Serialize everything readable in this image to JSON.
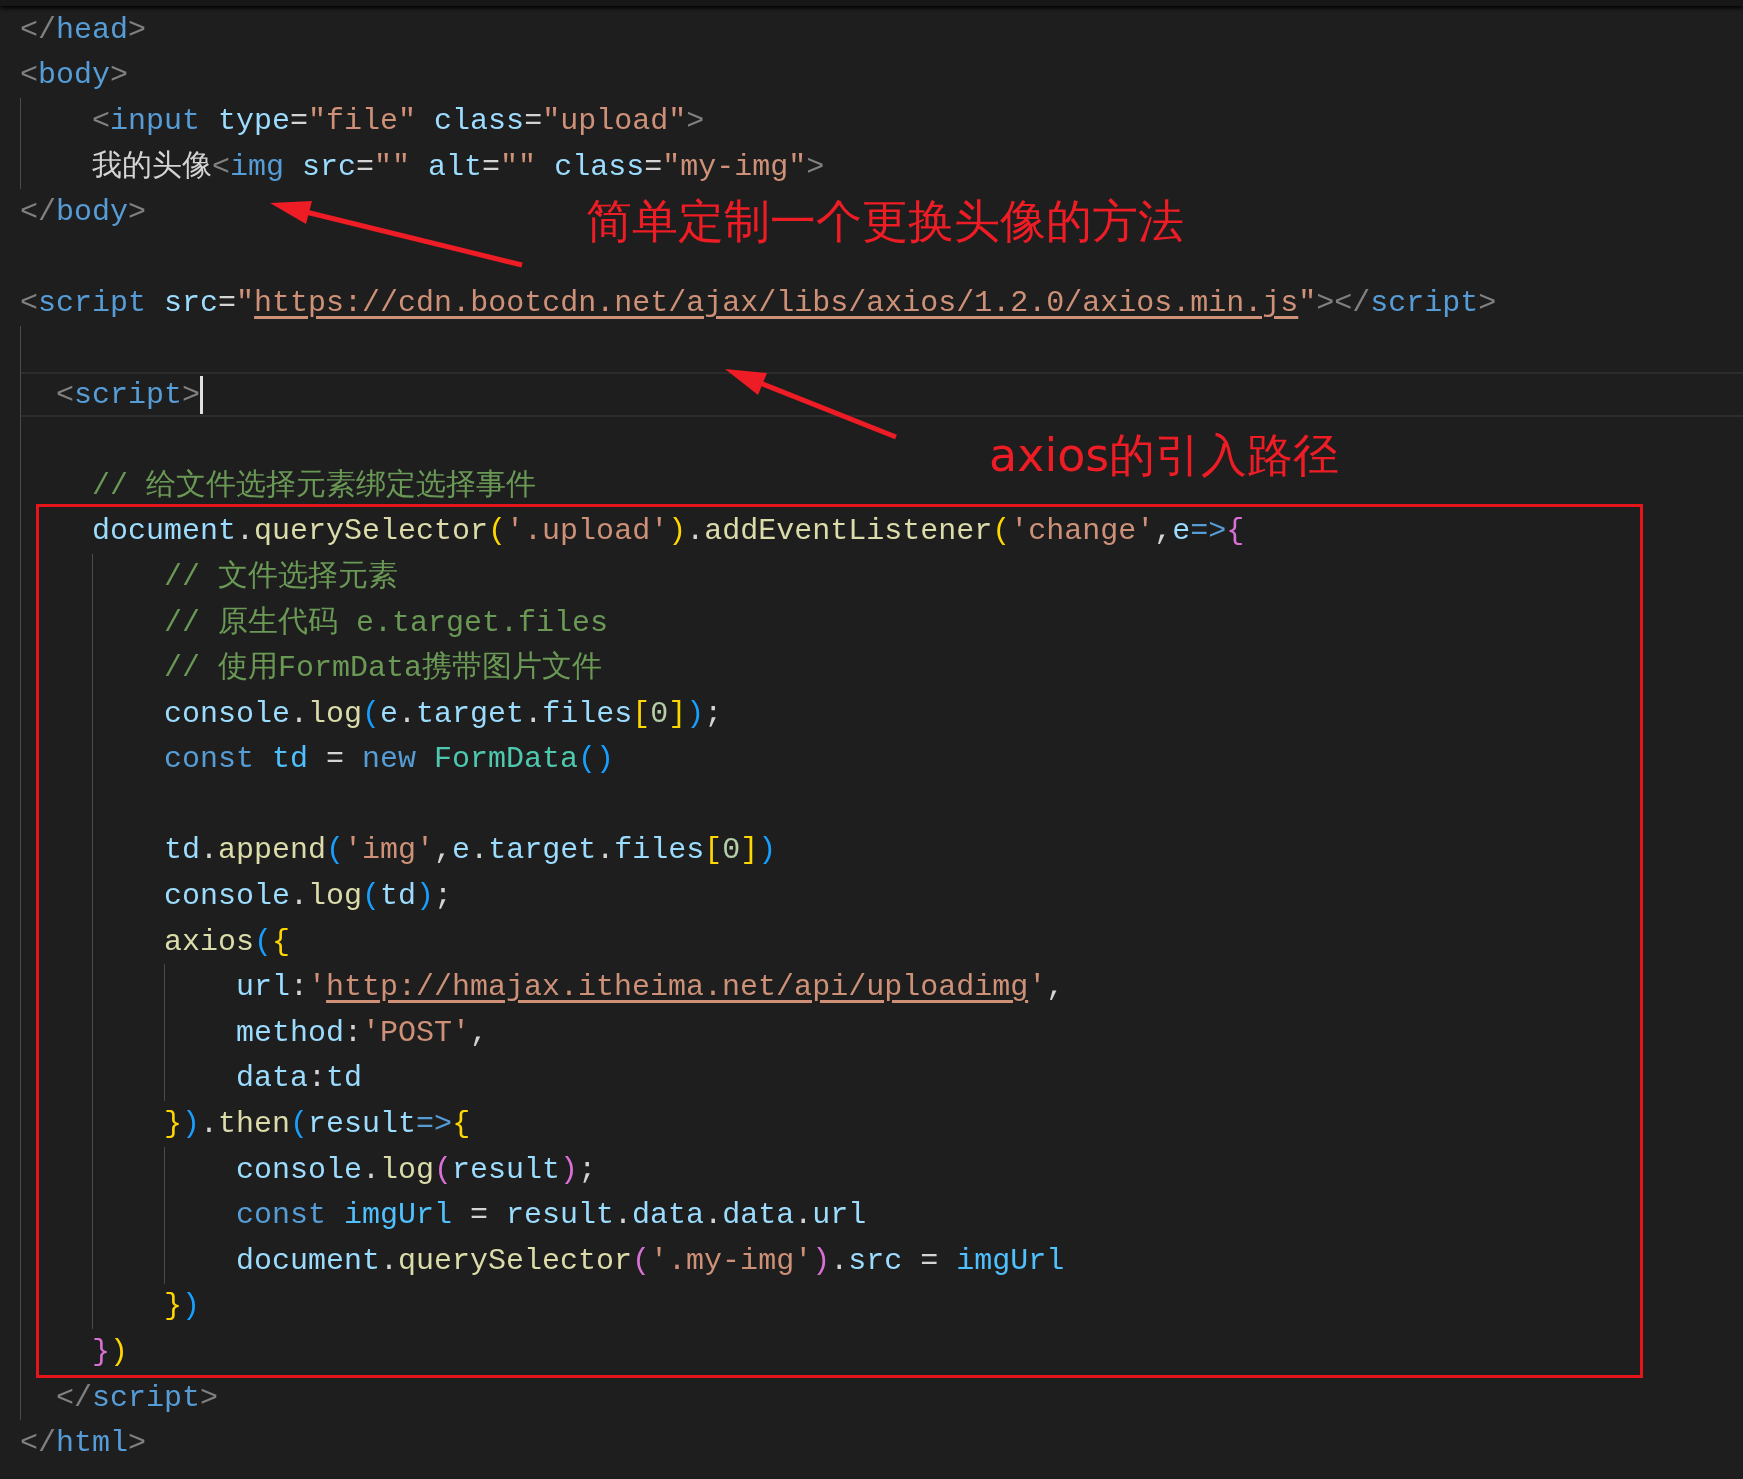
{
  "editor": {
    "lines": [
      {
        "kind": "code",
        "tokens": [
          {
            "kind": "p",
            "text": "</"
          },
          {
            "kind": "tag",
            "text": "head"
          },
          {
            "kind": "p",
            "text": ">"
          }
        ]
      },
      {
        "kind": "code",
        "tokens": [
          {
            "kind": "p",
            "text": "<"
          },
          {
            "kind": "tag",
            "text": "body"
          },
          {
            "kind": "p",
            "text": ">"
          }
        ],
        "children": [
          {
            "kind": "code",
            "tokens": [
              {
                "kind": "p",
                "text": "<"
              },
              {
                "kind": "tag",
                "text": "input"
              },
              {
                "kind": "attr",
                "text": " type"
              },
              {
                "kind": "op",
                "text": "="
              },
              {
                "kind": "str",
                "text": "\"file\""
              },
              {
                "kind": "attr",
                "text": " class"
              },
              {
                "kind": "op",
                "text": "="
              },
              {
                "kind": "str",
                "text": "\"upload\""
              },
              {
                "kind": "p",
                "text": ">"
              }
            ]
          },
          {
            "kind": "code",
            "tokens": [
              {
                "kind": "text",
                "text": "我的头像"
              },
              {
                "kind": "p",
                "text": "<"
              },
              {
                "kind": "tag",
                "text": "img"
              },
              {
                "kind": "attr",
                "text": " src"
              },
              {
                "kind": "op",
                "text": "="
              },
              {
                "kind": "str",
                "text": "\"\""
              },
              {
                "kind": "attr",
                "text": " alt"
              },
              {
                "kind": "op",
                "text": "="
              },
              {
                "kind": "str",
                "text": "\"\""
              },
              {
                "kind": "attr",
                "text": " class"
              },
              {
                "kind": "op",
                "text": "="
              },
              {
                "kind": "str",
                "text": "\"my-img\""
              },
              {
                "kind": "p",
                "text": ">"
              }
            ]
          }
        ]
      },
      {
        "kind": "code",
        "tokens": [
          {
            "kind": "p",
            "text": "</"
          },
          {
            "kind": "tag",
            "text": "body"
          },
          {
            "kind": "p",
            "text": ">"
          }
        ]
      },
      {
        "kind": "blank"
      },
      {
        "kind": "code",
        "tokens": [
          {
            "kind": "p",
            "text": "<"
          },
          {
            "kind": "tag",
            "text": "script"
          },
          {
            "kind": "attr",
            "text": " src"
          },
          {
            "kind": "op",
            "text": "="
          },
          {
            "kind": "str",
            "text": "\""
          },
          {
            "kind": "link",
            "text": "https://cdn.bootcdn.net/ajax/libs/axios/1.2.0/axios.min.js"
          },
          {
            "kind": "str",
            "text": "\""
          },
          {
            "kind": "p",
            "text": "></"
          },
          {
            "kind": "tag",
            "text": "script"
          },
          {
            "kind": "p",
            "text": ">"
          }
        ],
        "children": [
          {
            "kind": "blank"
          },
          {
            "kind": "half",
            "current": true,
            "tokens": [
              {
                "kind": "p",
                "text": "<"
              },
              {
                "kind": "tag",
                "text": "script"
              },
              {
                "kind": "p",
                "text": ">"
              }
            ]
          },
          {
            "kind": "blank"
          },
          {
            "kind": "code",
            "tokens": [
              {
                "kind": "cmt",
                "text": "// 给文件选择元素绑定选择事件"
              }
            ]
          },
          {
            "kind": "code",
            "tokens": [
              {
                "kind": "var",
                "text": "document"
              },
              {
                "kind": "op",
                "text": "."
              },
              {
                "kind": "fn",
                "text": "querySelector"
              },
              {
                "kind": "b1",
                "text": "("
              },
              {
                "kind": "str",
                "text": "'.upload'"
              },
              {
                "kind": "b1",
                "text": ")"
              },
              {
                "kind": "op",
                "text": "."
              },
              {
                "kind": "fn",
                "text": "addEventListener"
              },
              {
                "kind": "b1",
                "text": "("
              },
              {
                "kind": "str",
                "text": "'change'"
              },
              {
                "kind": "op",
                "text": ","
              },
              {
                "kind": "var",
                "text": "e"
              },
              {
                "kind": "kw",
                "text": "=>"
              },
              {
                "kind": "b2",
                "text": "{"
              }
            ],
            "children": [
              {
                "kind": "code",
                "tokens": [
                  {
                    "kind": "cmt",
                    "text": "// 文件选择元素"
                  }
                ]
              },
              {
                "kind": "code",
                "tokens": [
                  {
                    "kind": "cmt",
                    "text": "// 原生代码 e.target.files"
                  }
                ]
              },
              {
                "kind": "code",
                "tokens": [
                  {
                    "kind": "cmt",
                    "text": "// 使用FormData携带图片文件"
                  }
                ]
              },
              {
                "kind": "code",
                "tokens": [
                  {
                    "kind": "var",
                    "text": "console"
                  },
                  {
                    "kind": "op",
                    "text": "."
                  },
                  {
                    "kind": "fn",
                    "text": "log"
                  },
                  {
                    "kind": "b3",
                    "text": "("
                  },
                  {
                    "kind": "var",
                    "text": "e"
                  },
                  {
                    "kind": "op",
                    "text": "."
                  },
                  {
                    "kind": "var",
                    "text": "target"
                  },
                  {
                    "kind": "op",
                    "text": "."
                  },
                  {
                    "kind": "var",
                    "text": "files"
                  },
                  {
                    "kind": "b1",
                    "text": "["
                  },
                  {
                    "kind": "num",
                    "text": "0"
                  },
                  {
                    "kind": "b1",
                    "text": "]"
                  },
                  {
                    "kind": "b3",
                    "text": ")"
                  },
                  {
                    "kind": "op",
                    "text": ";"
                  }
                ]
              },
              {
                "kind": "code",
                "tokens": [
                  {
                    "kind": "kw",
                    "text": "const"
                  },
                  {
                    "kind": "cv",
                    "text": " td"
                  },
                  {
                    "kind": "op",
                    "text": " = "
                  },
                  {
                    "kind": "kw",
                    "text": "new"
                  },
                  {
                    "kind": "cls",
                    "text": " FormData"
                  },
                  {
                    "kind": "b3",
                    "text": "()"
                  }
                ]
              },
              {
                "kind": "blank"
              },
              {
                "kind": "code",
                "tokens": [
                  {
                    "kind": "var",
                    "text": "td"
                  },
                  {
                    "kind": "op",
                    "text": "."
                  },
                  {
                    "kind": "fn",
                    "text": "append"
                  },
                  {
                    "kind": "b3",
                    "text": "("
                  },
                  {
                    "kind": "str",
                    "text": "'img'"
                  },
                  {
                    "kind": "op",
                    "text": ","
                  },
                  {
                    "kind": "var",
                    "text": "e"
                  },
                  {
                    "kind": "op",
                    "text": "."
                  },
                  {
                    "kind": "var",
                    "text": "target"
                  },
                  {
                    "kind": "op",
                    "text": "."
                  },
                  {
                    "kind": "var",
                    "text": "files"
                  },
                  {
                    "kind": "b1",
                    "text": "["
                  },
                  {
                    "kind": "num",
                    "text": "0"
                  },
                  {
                    "kind": "b1",
                    "text": "]"
                  },
                  {
                    "kind": "b3",
                    "text": ")"
                  }
                ]
              },
              {
                "kind": "code",
                "tokens": [
                  {
                    "kind": "var",
                    "text": "console"
                  },
                  {
                    "kind": "op",
                    "text": "."
                  },
                  {
                    "kind": "fn",
                    "text": "log"
                  },
                  {
                    "kind": "b3",
                    "text": "("
                  },
                  {
                    "kind": "var",
                    "text": "td"
                  },
                  {
                    "kind": "b3",
                    "text": ")"
                  },
                  {
                    "kind": "op",
                    "text": ";"
                  }
                ]
              },
              {
                "kind": "code",
                "tokens": [
                  {
                    "kind": "fn",
                    "text": "axios"
                  },
                  {
                    "kind": "b3",
                    "text": "("
                  },
                  {
                    "kind": "b1",
                    "text": "{"
                  }
                ],
                "children": [
                  {
                    "kind": "code",
                    "tokens": [
                      {
                        "kind": "var",
                        "text": "url"
                      },
                      {
                        "kind": "op",
                        "text": ":"
                      },
                      {
                        "kind": "str",
                        "text": "'"
                      },
                      {
                        "kind": "link",
                        "text": "http://hmajax.itheima.net/api/uploadimg"
                      },
                      {
                        "kind": "str",
                        "text": "'"
                      },
                      {
                        "kind": "op",
                        "text": ","
                      }
                    ]
                  },
                  {
                    "kind": "code",
                    "tokens": [
                      {
                        "kind": "var",
                        "text": "method"
                      },
                      {
                        "kind": "op",
                        "text": ":"
                      },
                      {
                        "kind": "str",
                        "text": "'POST'"
                      },
                      {
                        "kind": "op",
                        "text": ","
                      }
                    ]
                  },
                  {
                    "kind": "code",
                    "tokens": [
                      {
                        "kind": "var",
                        "text": "data"
                      },
                      {
                        "kind": "op",
                        "text": ":"
                      },
                      {
                        "kind": "var",
                        "text": "td"
                      }
                    ]
                  }
                ]
              },
              {
                "kind": "code",
                "tokens": [
                  {
                    "kind": "b1",
                    "text": "}"
                  },
                  {
                    "kind": "b3",
                    "text": ")"
                  },
                  {
                    "kind": "op",
                    "text": "."
                  },
                  {
                    "kind": "fn",
                    "text": "then"
                  },
                  {
                    "kind": "b3",
                    "text": "("
                  },
                  {
                    "kind": "var",
                    "text": "result"
                  },
                  {
                    "kind": "kw",
                    "text": "=>"
                  },
                  {
                    "kind": "b1",
                    "text": "{"
                  }
                ],
                "children": [
                  {
                    "kind": "code",
                    "tokens": [
                      {
                        "kind": "var",
                        "text": "console"
                      },
                      {
                        "kind": "op",
                        "text": "."
                      },
                      {
                        "kind": "fn",
                        "text": "log"
                      },
                      {
                        "kind": "b2",
                        "text": "("
                      },
                      {
                        "kind": "var",
                        "text": "result"
                      },
                      {
                        "kind": "b2",
                        "text": ")"
                      },
                      {
                        "kind": "op",
                        "text": ";"
                      }
                    ]
                  },
                  {
                    "kind": "code",
                    "tokens": [
                      {
                        "kind": "kw",
                        "text": "const"
                      },
                      {
                        "kind": "cv",
                        "text": " imgUrl"
                      },
                      {
                        "kind": "op",
                        "text": " = "
                      },
                      {
                        "kind": "var",
                        "text": "result"
                      },
                      {
                        "kind": "op",
                        "text": "."
                      },
                      {
                        "kind": "var",
                        "text": "data"
                      },
                      {
                        "kind": "op",
                        "text": "."
                      },
                      {
                        "kind": "var",
                        "text": "data"
                      },
                      {
                        "kind": "op",
                        "text": "."
                      },
                      {
                        "kind": "var",
                        "text": "url"
                      }
                    ]
                  },
                  {
                    "kind": "code",
                    "tokens": [
                      {
                        "kind": "var",
                        "text": "document"
                      },
                      {
                        "kind": "op",
                        "text": "."
                      },
                      {
                        "kind": "fn",
                        "text": "querySelector"
                      },
                      {
                        "kind": "b2",
                        "text": "("
                      },
                      {
                        "kind": "str",
                        "text": "'.my-img'"
                      },
                      {
                        "kind": "b2",
                        "text": ")"
                      },
                      {
                        "kind": "op",
                        "text": "."
                      },
                      {
                        "kind": "var",
                        "text": "src"
                      },
                      {
                        "kind": "op",
                        "text": " = "
                      },
                      {
                        "kind": "cv",
                        "text": "imgUrl"
                      }
                    ]
                  }
                ]
              },
              {
                "kind": "code",
                "tokens": [
                  {
                    "kind": "b1",
                    "text": "}"
                  },
                  {
                    "kind": "b3",
                    "text": ")"
                  }
                ]
              }
            ]
          },
          {
            "kind": "code",
            "tokens": [
              {
                "kind": "b2",
                "text": "}"
              },
              {
                "kind": "b1",
                "text": ")"
              }
            ]
          },
          {
            "kind": "half",
            "tokens": [
              {
                "kind": "p",
                "text": "</"
              },
              {
                "kind": "tag",
                "text": "script"
              },
              {
                "kind": "p",
                "text": ">"
              }
            ]
          }
        ]
      },
      {
        "kind": "code",
        "tokens": [
          {
            "kind": "p",
            "text": "</"
          },
          {
            "kind": "tag",
            "text": "html"
          },
          {
            "kind": "p",
            "text": ">"
          }
        ]
      }
    ]
  },
  "annotations": [
    "简单定制一个更换头像的方法",
    "axios的引入路径"
  ]
}
